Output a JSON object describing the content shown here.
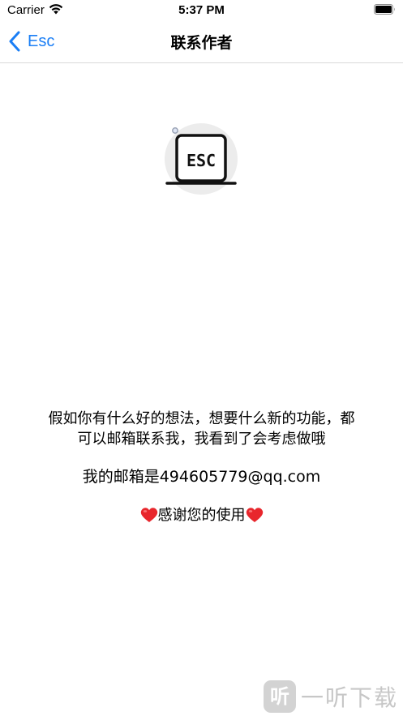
{
  "status_bar": {
    "carrier": "Carrier",
    "time": "5:37 PM",
    "wifi_icon": "wifi-icon",
    "battery_icon": "battery-full-icon"
  },
  "nav": {
    "back_label": "Esc",
    "title": "联系作者",
    "accent_color": "#1a7ef5"
  },
  "logo": {
    "icon": "esc-key-icon",
    "text": "ESC"
  },
  "message": {
    "line1": "假如你有什么好的想法，想要什么新的功能，都",
    "line2": "可以邮箱联系我，我看到了会考虑做哦",
    "email": "我的邮箱是494605779@qq.com",
    "thanks": "感谢您的使用"
  },
  "watermark": {
    "badge": "听",
    "text": "一听下载"
  }
}
